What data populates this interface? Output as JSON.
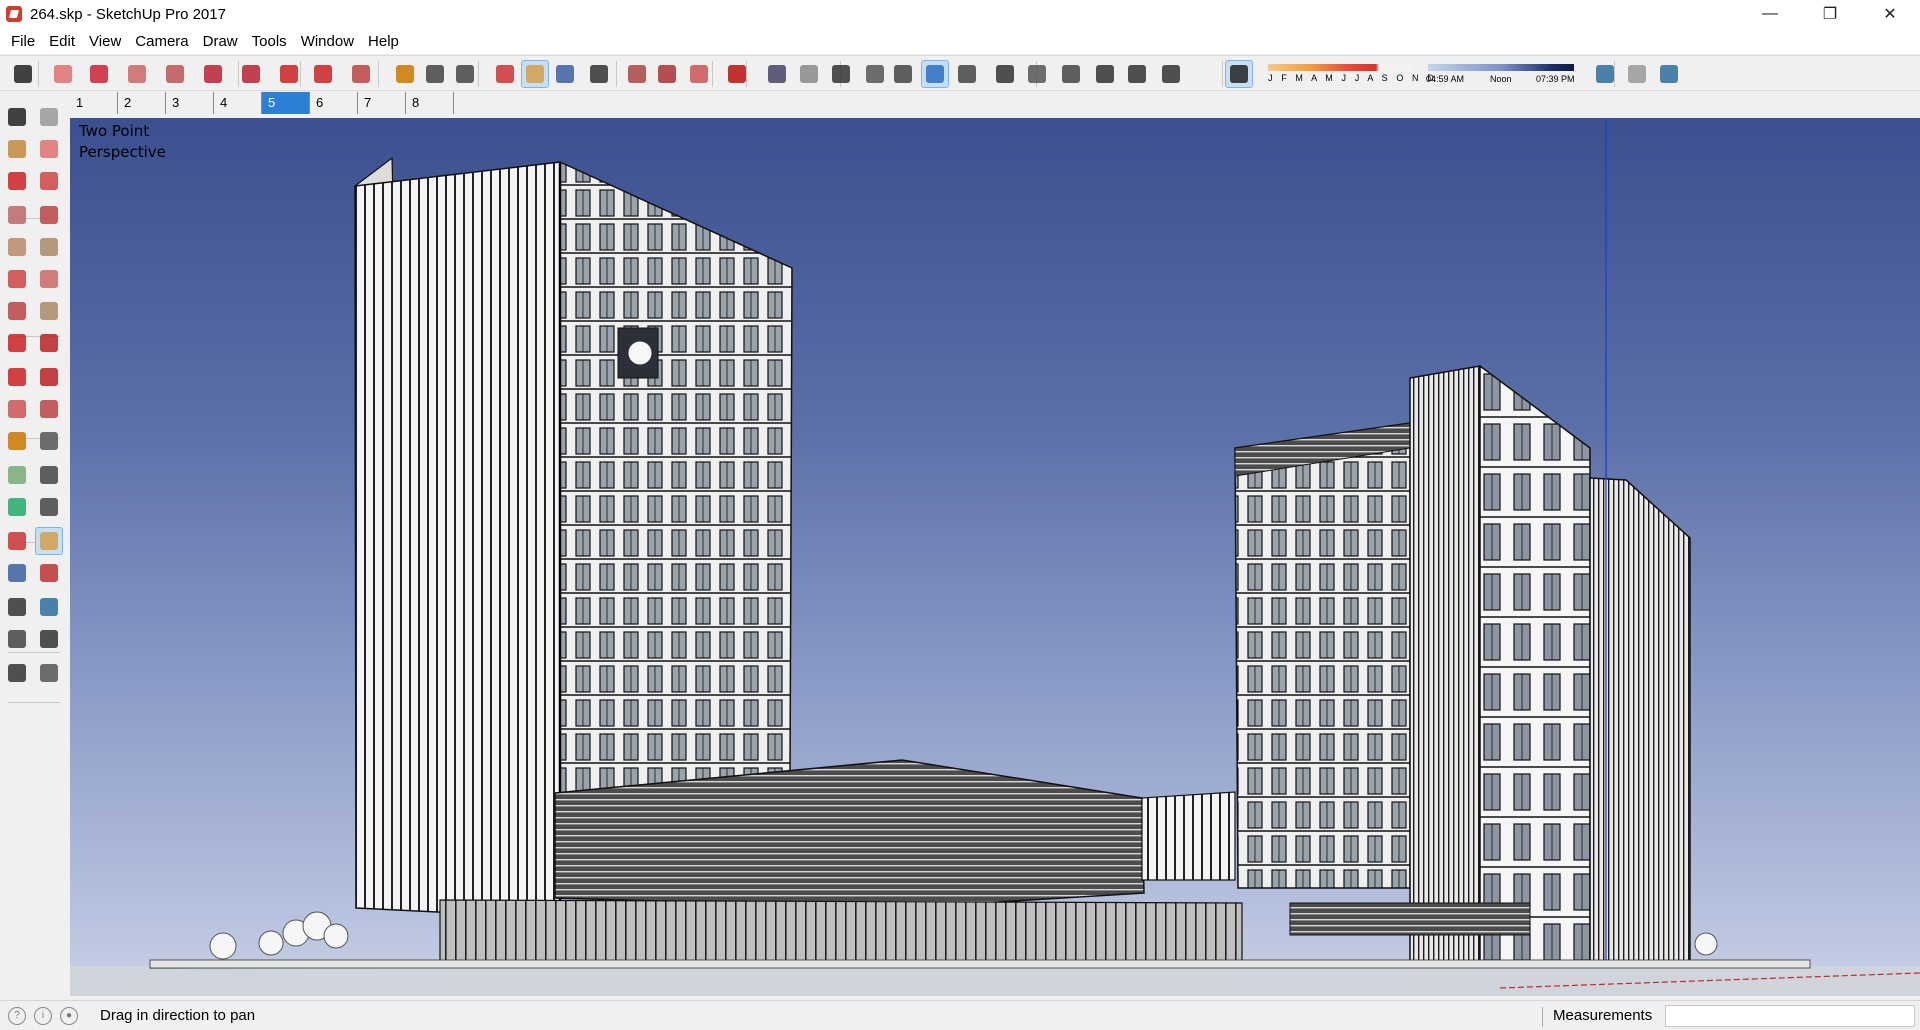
{
  "window": {
    "title": "264.skp - SketchUp Pro 2017",
    "controls": {
      "minimize": "—",
      "restore": "❐",
      "close": "✕"
    }
  },
  "menu": [
    "File",
    "Edit",
    "View",
    "Camera",
    "Draw",
    "Tools",
    "Window",
    "Help"
  ],
  "shadow": {
    "months": "J F M A M J J A S O N D",
    "time_start": "04:59 AM",
    "time_mid": "Noon",
    "time_end": "07:39 PM"
  },
  "scenes": {
    "tabs": [
      "1",
      "2",
      "3",
      "4",
      "5",
      "6",
      "7",
      "8"
    ],
    "active": "5"
  },
  "viewport": {
    "camera_label": "Two Point\nPerspective",
    "sky_color": "#3c4f90"
  },
  "status": {
    "hint": "Drag in direction to pan",
    "measurements_label": "Measurements",
    "measurements_value": ""
  },
  "toolbar_icons": [
    "select-icon",
    "eraser-icon",
    "line-icon",
    "arc-icon",
    "rectangle-icon",
    "push-pull-icon",
    "follow-me-icon",
    "move-icon",
    "rotate-icon",
    "scale-icon",
    "tape-measure-icon",
    "text-icon",
    "paint-bucket-icon",
    "orbit-icon",
    "pan-icon",
    "zoom-icon",
    "zoom-extents-icon",
    "warehouse-icon",
    "extension-warehouse-icon",
    "layout-icon",
    "ruby-icon",
    "xray-icon",
    "backedges-icon",
    "wireframe-icon",
    "hidden-line-icon",
    "shaded-icon",
    "shaded-textures-icon",
    "monochrome-icon",
    "iso-view-icon",
    "top-view-icon",
    "front-view-icon",
    "right-view-icon",
    "back-view-icon",
    "left-view-icon",
    "shadows-toggle-icon",
    "add-location-icon",
    "toggle-terrain-icon",
    "get-photo-texture-icon"
  ],
  "left_tool_icons": [
    "select-icon",
    "component-icon",
    "paint-bucket-icon",
    "eraser-icon",
    "line-icon",
    "freehand-icon",
    "rectangle-icon",
    "rotated-rectangle-icon",
    "circle-icon",
    "polygon-icon",
    "arc-icon",
    "two-point-arc-icon",
    "three-point-arc-icon",
    "pie-icon",
    "move-icon",
    "push-pull-icon",
    "rotate-icon",
    "follow-me-icon",
    "scale-icon",
    "offset-icon",
    "tape-measure-icon",
    "dimension-icon",
    "protractor-icon",
    "text-icon",
    "axes-icon",
    "3d-text-icon",
    "orbit-icon",
    "pan-icon",
    "zoom-icon",
    "zoom-window-icon",
    "zoom-extents-icon",
    "previous-view-icon",
    "position-camera-icon",
    "look-around-icon",
    "walk-icon",
    "section-plane-icon"
  ]
}
